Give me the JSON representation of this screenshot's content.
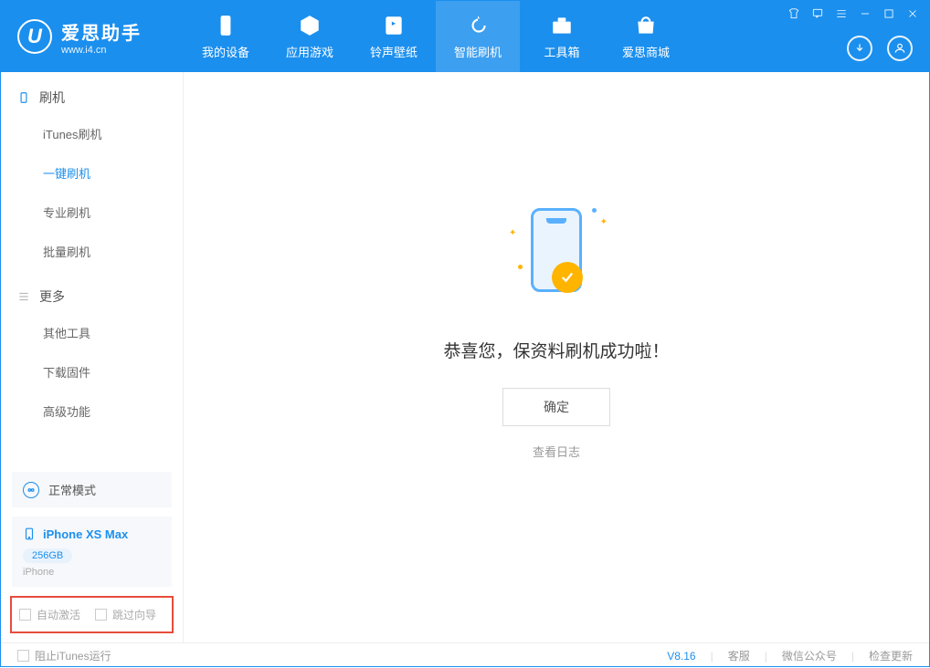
{
  "app": {
    "title": "爱思助手",
    "subtitle": "www.i4.cn"
  },
  "nav": {
    "items": [
      {
        "label": "我的设备"
      },
      {
        "label": "应用游戏"
      },
      {
        "label": "铃声壁纸"
      },
      {
        "label": "智能刷机"
      },
      {
        "label": "工具箱"
      },
      {
        "label": "爱思商城"
      }
    ]
  },
  "sidebar": {
    "section1": {
      "title": "刷机",
      "items": [
        {
          "label": "iTunes刷机"
        },
        {
          "label": "一键刷机"
        },
        {
          "label": "专业刷机"
        },
        {
          "label": "批量刷机"
        }
      ]
    },
    "section2": {
      "title": "更多",
      "items": [
        {
          "label": "其他工具"
        },
        {
          "label": "下载固件"
        },
        {
          "label": "高级功能"
        }
      ]
    },
    "mode": "正常模式",
    "device": {
      "name": "iPhone XS Max",
      "storage": "256GB",
      "type": "iPhone"
    },
    "cb1": "自动激活",
    "cb2": "跳过向导"
  },
  "main": {
    "success": "恭喜您，保资料刷机成功啦！",
    "confirm": "确定",
    "log": "查看日志"
  },
  "footer": {
    "block_itunes": "阻止iTunes运行",
    "version": "V8.16",
    "service": "客服",
    "wechat": "微信公众号",
    "update": "检查更新"
  }
}
